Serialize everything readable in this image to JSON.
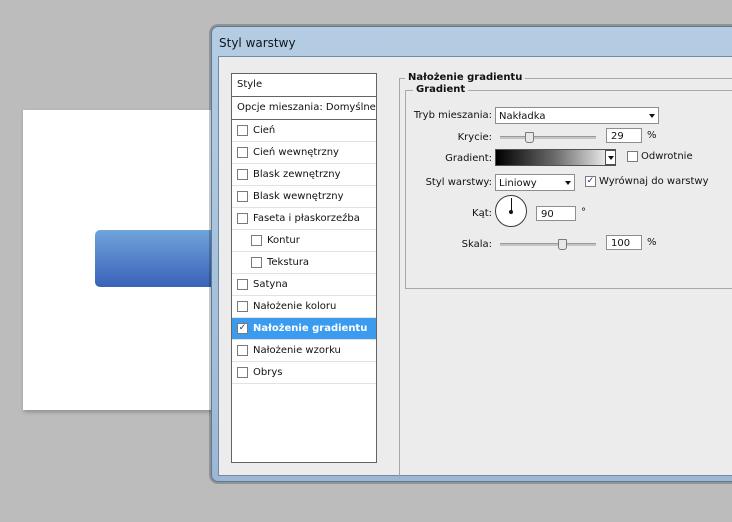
{
  "dialog": {
    "title": "Styl warstwy"
  },
  "styles_list": {
    "header": "Style",
    "blending_options": "Opcje mieszania: Domyślne",
    "items": [
      {
        "label": "Cień",
        "checked": false
      },
      {
        "label": "Cień wewnętrzny",
        "checked": false
      },
      {
        "label": "Blask zewnętrzny",
        "checked": false
      },
      {
        "label": "Blask wewnętrzny",
        "checked": false
      },
      {
        "label": "Faseta i płaskorzeźba",
        "checked": false
      },
      {
        "label": "Kontur",
        "checked": false
      },
      {
        "label": "Tekstura",
        "checked": false
      },
      {
        "label": "Satyna",
        "checked": false
      },
      {
        "label": "Nałożenie koloru",
        "checked": false
      },
      {
        "label": "Nałożenie gradientu",
        "checked": true
      },
      {
        "label": "Nałożenie wzorku",
        "checked": false
      },
      {
        "label": "Obrys",
        "checked": false
      }
    ]
  },
  "panel": {
    "section_title": "Nałożenie gradientu",
    "group_title": "Gradient",
    "blend_mode": {
      "label": "Tryb mieszania:",
      "value": "Nakładka"
    },
    "opacity": {
      "label": "Krycie:",
      "value": "29",
      "unit": "%",
      "level": 0.29
    },
    "gradient": {
      "label": "Gradient:",
      "reverse_label": "Odwrotnie",
      "reverse_checked": false
    },
    "style": {
      "label": "Styl warstwy:",
      "value": "Liniowy",
      "align_label": "Wyrównaj do warstwy",
      "align_checked": true
    },
    "angle": {
      "label": "Kąt:",
      "value": "90",
      "unit": "°"
    },
    "scale": {
      "label": "Skala:",
      "value": "100",
      "unit": "%",
      "level": 0.6
    }
  }
}
